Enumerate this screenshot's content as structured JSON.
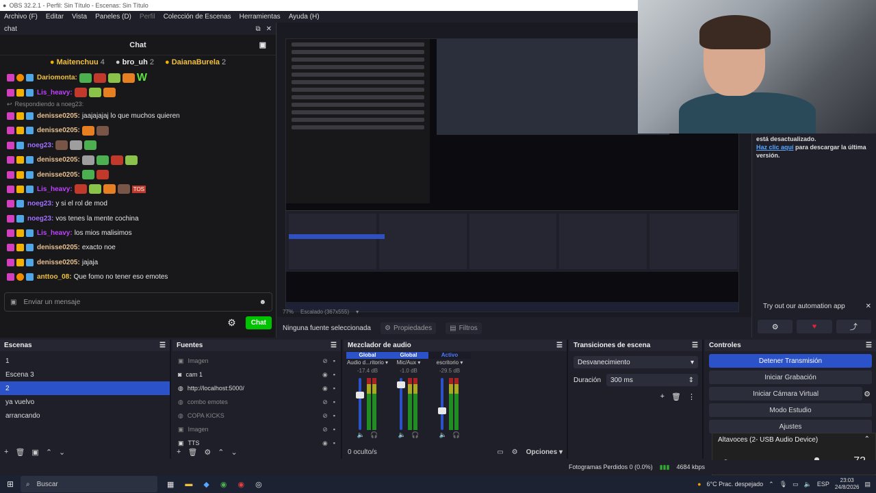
{
  "window_title": "OBS 32.2.1 - Perfil: Sin Título - Escenas: Sin Título",
  "menu": [
    "Archivo (F)",
    "Editar",
    "Vista",
    "Paneles (D)",
    "Perfil",
    "Colección de Escenas",
    "Herramientas",
    "Ayuda (H)"
  ],
  "chat": {
    "dock_title": "chat",
    "title": "Chat",
    "top_chatters": [
      {
        "name": "Maitenchuu",
        "count": "4"
      },
      {
        "name": "bro_uh",
        "count": "2"
      },
      {
        "name": "DaianaBurela",
        "count": "2"
      }
    ],
    "reply_text": "Respondiendo a noeg23:",
    "messages": [
      {
        "user": "Dariomonta:",
        "text": "W",
        "color": "#f0c040",
        "badges": [
          "b-pink",
          "b-orange",
          "b-blue"
        ]
      },
      {
        "user": "Lis_heavy:",
        "text": "",
        "color": "#c040ff",
        "badges": [
          "b-pink",
          "b-yellow",
          "b-blue"
        ]
      },
      {
        "user": "denisse0205:",
        "text": "jaajajajaj lo que muchos quieren",
        "color": "#e8c090",
        "badges": [
          "b-pink",
          "b-yellow",
          "b-blue"
        ]
      },
      {
        "user": "denisse0205:",
        "text": "",
        "color": "#e8c090",
        "badges": [
          "b-pink",
          "b-yellow",
          "b-blue"
        ]
      },
      {
        "user": "noeg23:",
        "text": "",
        "color": "#a070ff",
        "badges": [
          "b-pink",
          "b-blue"
        ]
      },
      {
        "user": "denisse0205:",
        "text": "",
        "color": "#e8c090",
        "badges": [
          "b-pink",
          "b-yellow",
          "b-blue"
        ]
      },
      {
        "user": "denisse0205:",
        "text": "",
        "color": "#e8c090",
        "badges": [
          "b-pink",
          "b-yellow",
          "b-blue"
        ]
      },
      {
        "user": "Lis_heavy:",
        "text": "TOS",
        "color": "#c040ff",
        "badges": [
          "b-pink",
          "b-yellow",
          "b-blue"
        ]
      },
      {
        "user": "noeg23:",
        "text": "y si el rol de mod",
        "color": "#a070ff",
        "badges": [
          "b-pink",
          "b-blue"
        ]
      },
      {
        "user": "noeg23:",
        "text": "vos tenes la mente cochina",
        "color": "#a070ff",
        "badges": [
          "b-pink",
          "b-blue"
        ]
      },
      {
        "user": "Lis_heavy:",
        "text": "los mios malisimos",
        "color": "#c040ff",
        "badges": [
          "b-pink",
          "b-yellow",
          "b-blue"
        ]
      },
      {
        "user": "denisse0205:",
        "text": "exacto noe",
        "color": "#e8c090",
        "badges": [
          "b-pink",
          "b-yellow",
          "b-blue"
        ]
      },
      {
        "user": "denisse0205:",
        "text": "jajaja",
        "color": "#e8c090",
        "badges": [
          "b-pink",
          "b-yellow",
          "b-blue"
        ]
      },
      {
        "user": "anttoo_08:",
        "text": "Que fomo no tener eso emotes",
        "color": "#f0c040",
        "badges": [
          "b-pink",
          "b-orange",
          "b-blue"
        ]
      }
    ],
    "input_placeholder": "Enviar un mensaje",
    "send_label": "Chat"
  },
  "preview": {
    "zoom": "77%",
    "scale": "Escalado (367x555)",
    "no_source": "Ninguna fuente seleccionada",
    "properties": "Propiedades",
    "filters": "Filtros"
  },
  "update_dock": {
    "line1": "está desactualizado.",
    "link": "Haz clic aquí",
    "line2": " para descargar la última versión.",
    "automation": "Try out our automation app"
  },
  "scenes": {
    "title": "Escenas",
    "items": [
      {
        "label": "1"
      },
      {
        "label": "Escena 3"
      },
      {
        "label": "2",
        "selected": true
      },
      {
        "label": "ya vuelvo"
      },
      {
        "label": "arrancando"
      }
    ]
  },
  "sources": {
    "title": "Fuentes",
    "items": [
      {
        "label": "Imagen",
        "dim": true,
        "icon": "image-icon"
      },
      {
        "label": "cam 1",
        "dim": false,
        "icon": "camera-icon"
      },
      {
        "label": "http://localhost:5000/",
        "dim": false,
        "icon": "globe-icon"
      },
      {
        "label": "combo emotes",
        "dim": true,
        "icon": "globe-icon"
      },
      {
        "label": "COPA KICKS",
        "dim": true,
        "icon": "globe-icon"
      },
      {
        "label": "Imagen",
        "dim": true,
        "icon": "image-icon"
      },
      {
        "label": "TTS",
        "dim": false,
        "icon": "image-icon"
      }
    ]
  },
  "mixer": {
    "title": "Mezclador de audio",
    "channels": [
      {
        "tag": "Global",
        "name": "Audio d...ritorio",
        "db": "-17.4 dB",
        "level": 0.7
      },
      {
        "tag": "Global",
        "name": "Mic/Aux",
        "db": "-1.0 dB",
        "level": 0.92
      },
      {
        "tag": "Activo",
        "name": "escritorio",
        "db": "-29.5 dB",
        "level": 0.35
      }
    ],
    "hidden": "0 oculto/s",
    "options": "Opciones"
  },
  "transitions": {
    "title": "Transiciones de escena",
    "selected": "Desvanecimiento",
    "duration_label": "Duración",
    "duration_value": "300 ms"
  },
  "controls": {
    "title": "Controles",
    "stop_stream": "Detener Transmisión",
    "start_recording": "Iniciar Grabación",
    "start_virtual_cam": "Iniciar Cámara Virtual",
    "studio_mode": "Modo Estudio",
    "settings": "Ajustes"
  },
  "volume_popup": {
    "device": "Altavoces (2- USB Audio Device)",
    "value": "72",
    "level": 0.72
  },
  "status": {
    "dropped_frames": "Fotogramas Perdidos 0 (0.0%)",
    "bitrate": "4684 kbps"
  },
  "taskbar": {
    "search": "Buscar",
    "weather": "6°C  Prac. despejado",
    "lang": "ESP",
    "time": "23:03",
    "date": "24/8/2026"
  }
}
